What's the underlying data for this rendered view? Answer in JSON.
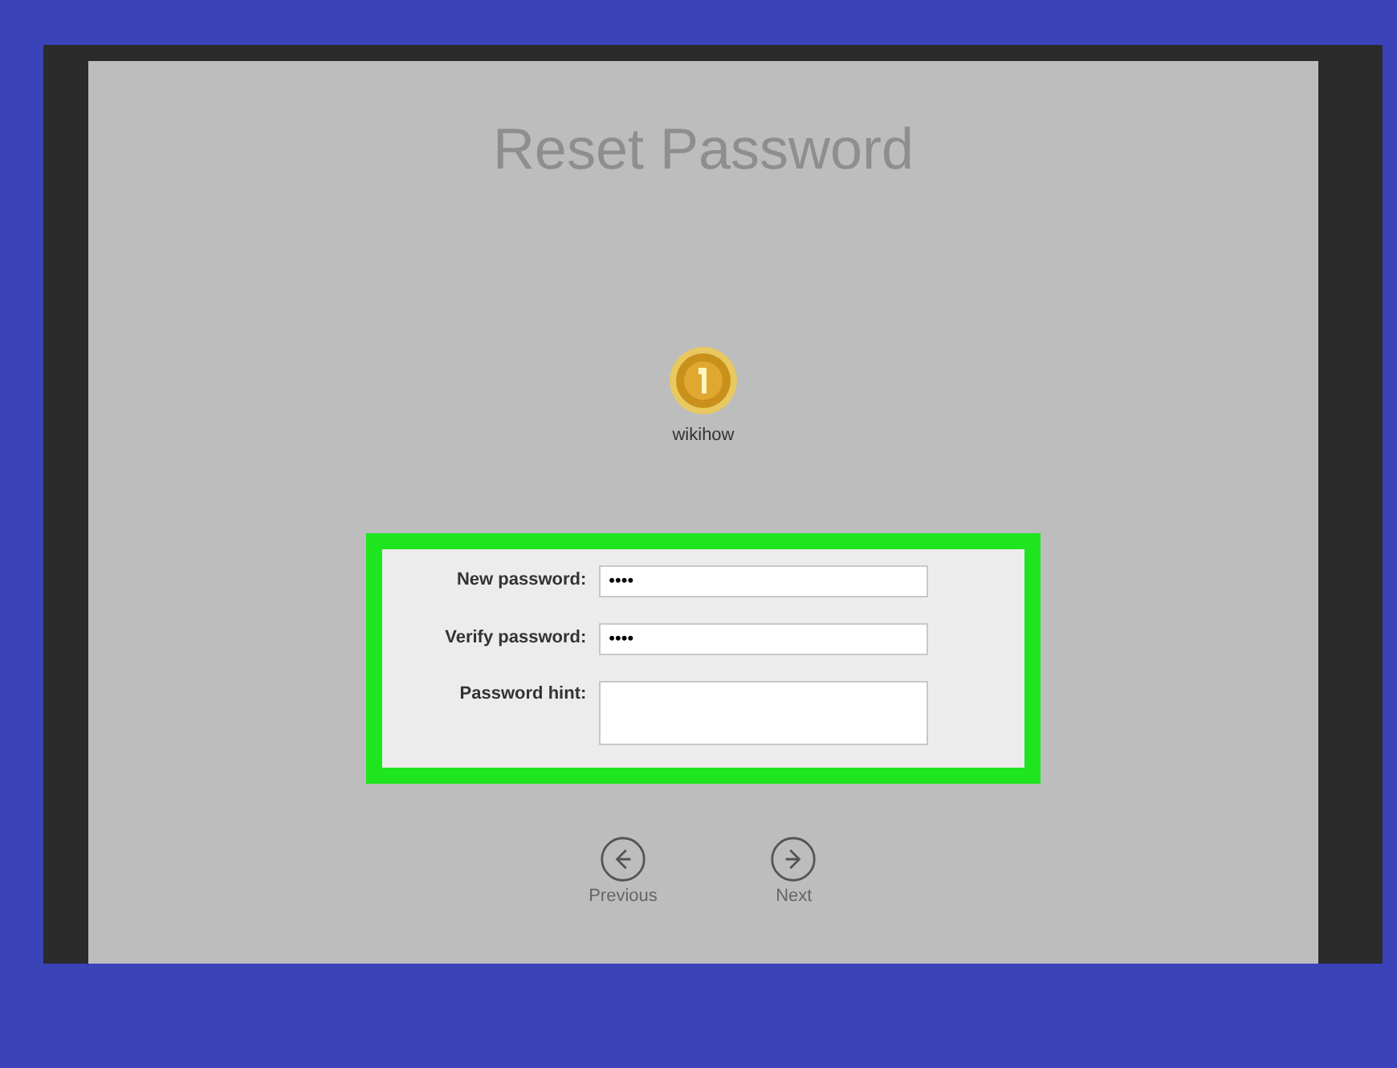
{
  "title": "Reset Password",
  "user": {
    "name": "wikihow"
  },
  "fields": [
    {
      "label": "New password:",
      "value": "••••",
      "kind": "line"
    },
    {
      "label": "Verify password:",
      "value": "••••",
      "kind": "line"
    },
    {
      "label": "Password hint:",
      "kind": "area"
    }
  ],
  "nav": [
    {
      "label": "Previous",
      "kind": "back"
    },
    {
      "label": "Next",
      "kind": "forward"
    }
  ]
}
